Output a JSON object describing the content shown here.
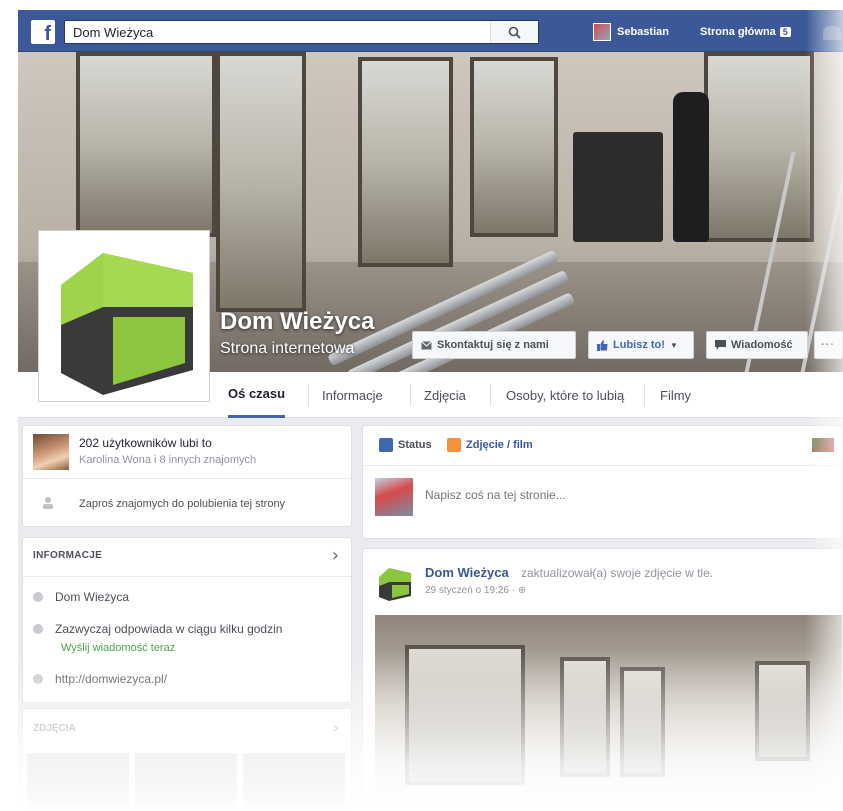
{
  "topbar": {
    "logo_letter": "f",
    "search_value": "Dom Wieżyca",
    "user_name": "Sebastian",
    "home_label": "Strona główna",
    "home_badge": "5"
  },
  "page": {
    "name": "Dom Wieżyca",
    "category": "Strona internetowa"
  },
  "cover_buttons": {
    "contact": "Skontaktuj się z nami",
    "like": "Lubisz to!",
    "message": "Wiadomość",
    "more": "···"
  },
  "tabs": [
    {
      "label": "Oś czasu",
      "active": true
    },
    {
      "label": "Informacje"
    },
    {
      "label": "Zdjęcia"
    },
    {
      "label": "Osoby, które to lubią"
    },
    {
      "label": "Filmy"
    }
  ],
  "likes": {
    "count_text": "202 użytkowników lubi to",
    "friends_text": "Karolina Wona i 8 innych znajomych",
    "invite_text": "Zaproś znajomych do polubienia tej strony"
  },
  "info": {
    "header": "INFORMACJE",
    "name": "Dom Wieżyca",
    "response": "Zazwyczaj odpowiada w ciągu kilku godzin",
    "send_message": "Wyślij wiadomość teraz",
    "website": "http://domwiezyca.pl/"
  },
  "photos": {
    "header": "ZDJĘCIA"
  },
  "composer": {
    "status_label": "Status",
    "photo_label": "Zdjęcie / film",
    "placeholder": "Napisz coś na tej stronie..."
  },
  "post": {
    "author": "Dom Wieżyca",
    "action": "zaktualizował(a) swoje zdjęcie w tle.",
    "time": "29 styczeń o 19:26 · ⊕"
  },
  "colors": {
    "brand_blue": "#3b5998",
    "link_blue": "#365899",
    "house_green": "#8cc63f",
    "house_dark": "#3a3a3a"
  }
}
